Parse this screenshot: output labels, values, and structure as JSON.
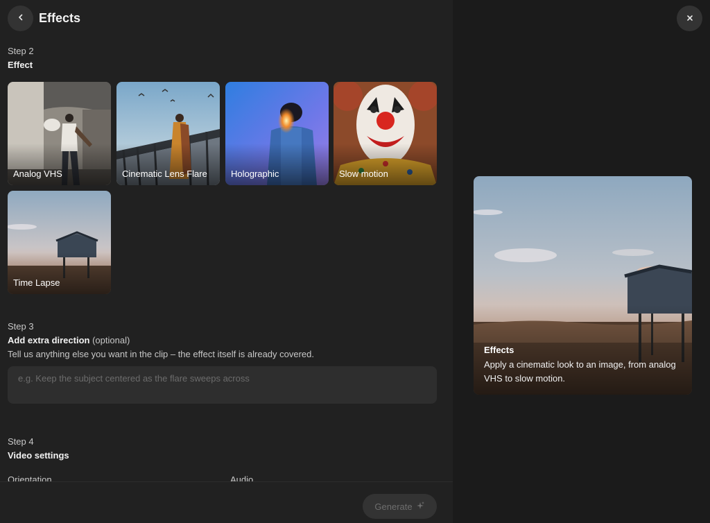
{
  "header": {
    "title": "Effects"
  },
  "step2": {
    "label": "Step 2",
    "heading": "Effect",
    "effects": [
      {
        "label": "Analog VHS"
      },
      {
        "label": "Cinematic Lens Flare"
      },
      {
        "label": "Holographic"
      },
      {
        "label": "Slow motion"
      },
      {
        "label": "Time Lapse"
      }
    ]
  },
  "step3": {
    "label": "Step 3",
    "heading": "Add extra direction",
    "optional": "(optional)",
    "help": "Tell us anything else you want in the clip – the effect itself is already covered.",
    "placeholder": "e.g. Keep the subject centered as the flare sweeps across",
    "value": ""
  },
  "step4": {
    "label": "Step 4",
    "heading": "Video settings",
    "orientation_label": "Orientation",
    "audio_label": "Audio"
  },
  "footer": {
    "generate_label": "Generate"
  },
  "preview": {
    "title": "Effects",
    "description": "Apply a cinematic look to an image, from analog VHS to slow motion."
  },
  "icons": {
    "back": "chevron-left-icon",
    "close": "close-icon",
    "generate": "sparkle-icon"
  },
  "colors": {
    "left_panel_bg": "#212121",
    "right_panel_bg": "#1b1b1b",
    "button_bg": "#333333",
    "input_bg": "#2e2e2e",
    "text_primary": "#f2f2f2",
    "text_secondary": "#c8c8c8",
    "disabled_text": "#6e6e6e"
  }
}
